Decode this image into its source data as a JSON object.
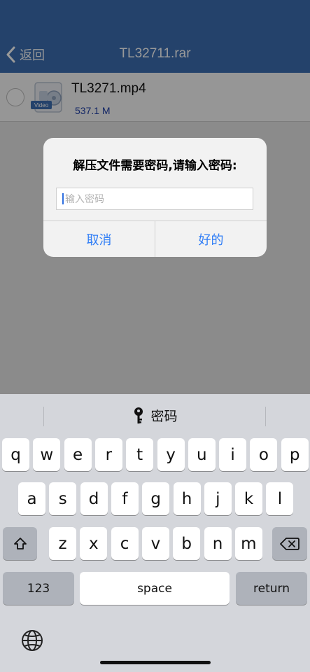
{
  "navbar": {
    "back_label": "返回",
    "title": "TL32711.rar",
    "color": "#3d6fb2"
  },
  "file": {
    "name": "TL3271.mp4",
    "size": "537.1 M",
    "badge": "Video"
  },
  "dialog": {
    "message": "解压文件需要密码,请输入密码:",
    "placeholder": "输入密码",
    "cancel_label": "取消",
    "ok_label": "好的",
    "accent": "#2f7df6"
  },
  "keyboard": {
    "suggestion": "密码",
    "row1": [
      "q",
      "w",
      "e",
      "r",
      "t",
      "y",
      "u",
      "i",
      "o",
      "p"
    ],
    "row2": [
      "a",
      "s",
      "d",
      "f",
      "g",
      "h",
      "j",
      "k",
      "l"
    ],
    "row3": [
      "z",
      "x",
      "c",
      "v",
      "b",
      "n",
      "m"
    ],
    "numbers_label": "123",
    "space_label": "space",
    "return_label": "return"
  }
}
